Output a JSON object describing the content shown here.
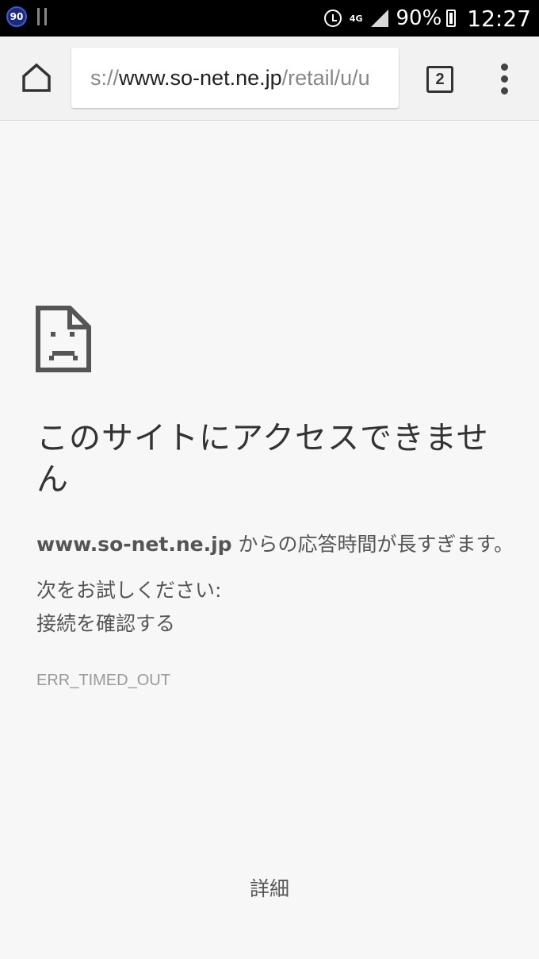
{
  "status_bar": {
    "notification_badge": "90",
    "network_type": "4G",
    "battery_percent": "90%",
    "time": "12:27",
    "icons": [
      "usb-debug-icon",
      "alarm-icon",
      "signal-icon",
      "battery-icon"
    ]
  },
  "toolbar": {
    "url_prefix": "s://",
    "url_host": "www.so-net.ne.jp",
    "url_path": "/retail/u/u",
    "tab_count": "2",
    "icons": [
      "home-icon",
      "more-vert-icon"
    ]
  },
  "error": {
    "title": "このサイトにアクセスできません",
    "host": "www.so-net.ne.jp",
    "message_suffix": " からの応答時間が長すぎます。",
    "try_label": "次をお試しください:",
    "suggestion": "接続を確認する",
    "code": "ERR_TIMED_OUT",
    "details_label": "詳細",
    "icon": "sad-page-icon"
  },
  "colors": {
    "background": "#f7f7f7",
    "status_bar": "#000000",
    "badge": "#1c2a7a"
  }
}
